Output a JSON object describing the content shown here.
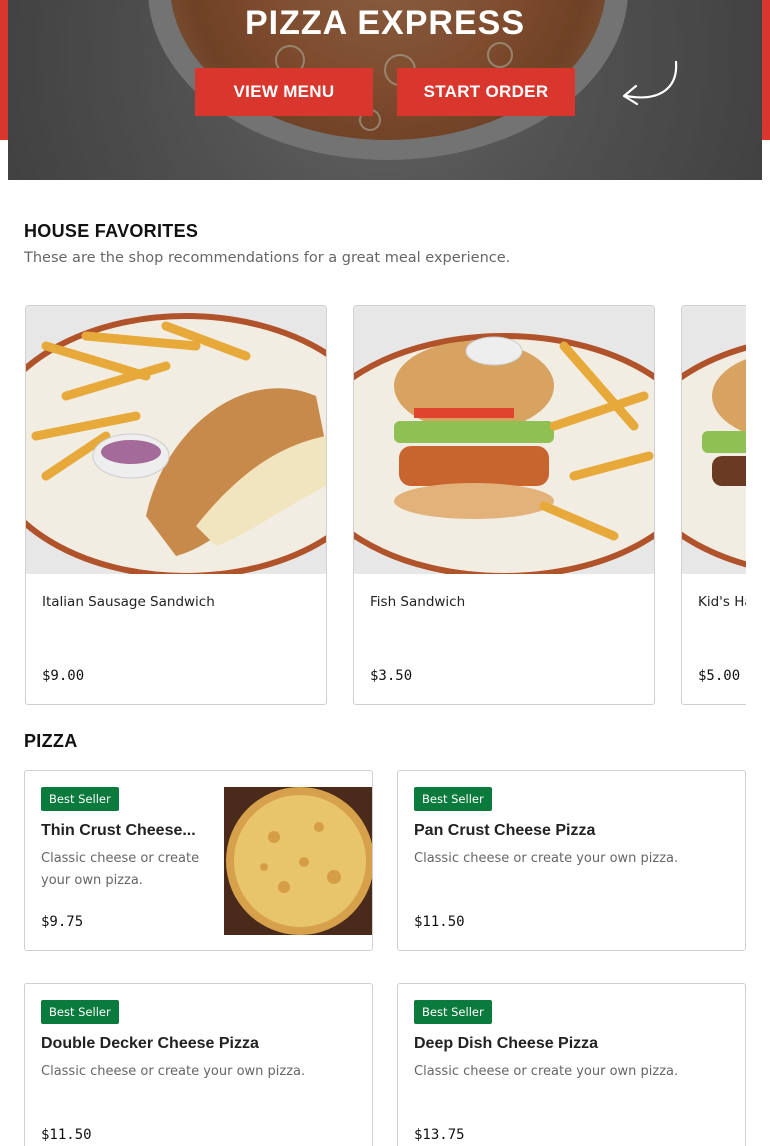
{
  "hero": {
    "title": "PIZZA EXPRESS",
    "view_menu_label": "VIEW MENU",
    "start_order_label": "START ORDER"
  },
  "house_favorites": {
    "title": "HOUSE FAVORITES",
    "subtitle": "These are the shop recommendations for a great meal experience.",
    "items": [
      {
        "name": "Italian Sausage Sandwich",
        "price": "$9.00"
      },
      {
        "name": "Fish Sandwich",
        "price": "$3.50"
      },
      {
        "name": "Kid's Ha",
        "price": "$5.00"
      }
    ]
  },
  "pizza": {
    "title": "PIZZA",
    "items": [
      {
        "badge": "Best Seller",
        "name": "Thin Crust Cheese...",
        "description": "Classic cheese or create your own pizza.",
        "price": "$9.75"
      },
      {
        "badge": "Best Seller",
        "name": "Pan Crust Cheese Pizza",
        "description": "Classic cheese or create your own pizza.",
        "price": "$11.50"
      },
      {
        "badge": "Best Seller",
        "name": "Double Decker Cheese Pizza",
        "description": "Classic cheese or create your own pizza.",
        "price": "$11.50"
      },
      {
        "badge": "Best Seller",
        "name": "Deep Dish Cheese Pizza",
        "description": "Classic cheese or create your own pizza.",
        "price": "$13.75"
      }
    ]
  },
  "colors": {
    "brand_red": "#d9372e",
    "badge_green": "#0b7a3d"
  },
  "icons": {
    "hero_arrow": "curved-arrow-icon"
  }
}
